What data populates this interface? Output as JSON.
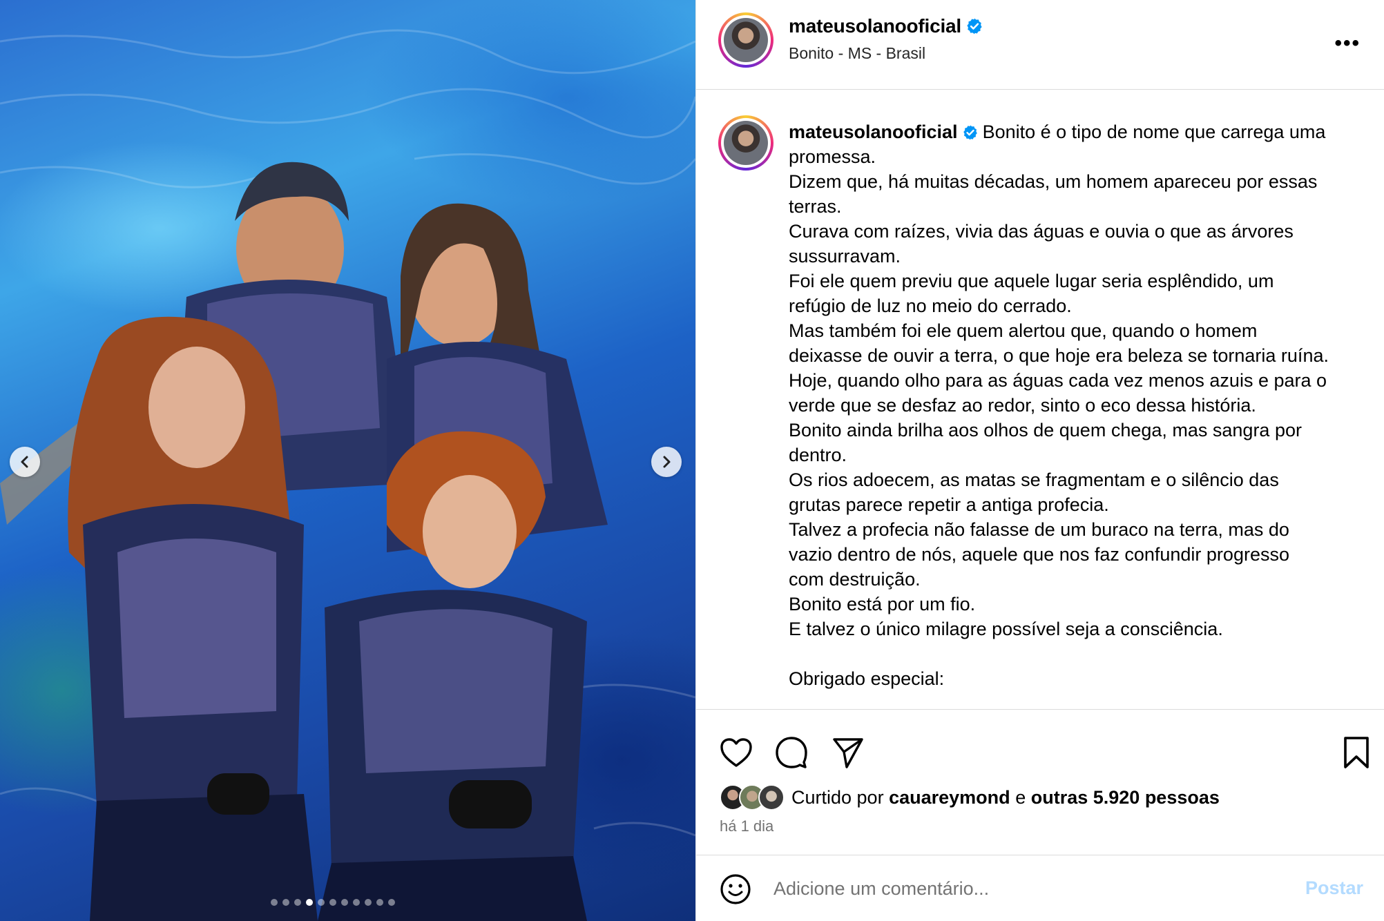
{
  "colors": {
    "verified": "#0095f6",
    "post_button": "#b3dbff",
    "muted": "#737373"
  },
  "media": {
    "alt": "",
    "carousel_total": 11,
    "carousel_active": 3
  },
  "header": {
    "username": "mateusolanooficial",
    "location": "Bonito - MS - Brasil",
    "more_icon": "more-horizontal-icon"
  },
  "caption": {
    "username": "mateusolanooficial",
    "first_line": "Bonito é o tipo de nome que carrega uma",
    "lines": [
      "promessa.",
      "Dizem que, há muitas décadas, um homem apareceu por essas",
      "terras.",
      "Curava com raízes, vivia das águas e ouvia o que as árvores",
      "sussurravam.",
      "Foi ele quem previu que aquele lugar seria esplêndido, um",
      "refúgio de luz no meio do cerrado.",
      "Mas também foi ele quem alertou que, quando o homem",
      "deixasse de ouvir a terra, o que hoje era beleza se tornaria ruína.",
      "Hoje, quando olho para as águas cada vez menos azuis e para o",
      "verde que se desfaz ao redor, sinto o eco dessa história.",
      "Bonito ainda brilha aos olhos de quem chega, mas sangra por",
      "dentro.",
      "Os rios adoecem, as matas se fragmentam e o silêncio das",
      "grutas parece repetir a antiga profecia.",
      "Talvez a profecia não falasse de um buraco na terra, mas do",
      "vazio dentro de nós, aquele que nos faz confundir progresso",
      "com destruição.",
      "Bonito está por um fio.",
      "E talvez o único milagre possível seja a consciência.",
      "",
      "Obrigado especial:"
    ]
  },
  "actions": {
    "like_icon": "heart-icon",
    "comment_icon": "comment-icon",
    "share_icon": "share-icon",
    "save_icon": "bookmark-icon"
  },
  "likes": {
    "prefix": "Curtido por",
    "user": "cauareymond",
    "connector": "e",
    "others": "outras 5.920 pessoas"
  },
  "timestamp": "há 1 dia",
  "comment": {
    "placeholder": "Adicione um comentário...",
    "post_label": "Postar",
    "emoji_icon": "emoji-icon"
  }
}
